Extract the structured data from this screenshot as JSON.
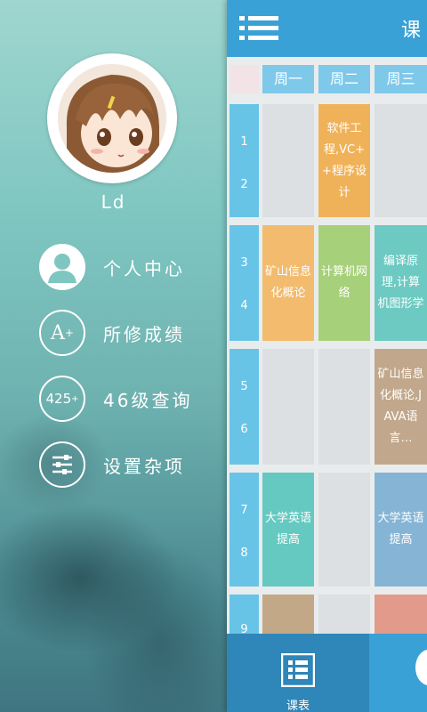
{
  "drawer": {
    "username": "Ld",
    "menu": [
      {
        "label": "个人中心",
        "icon": "person-icon"
      },
      {
        "label": "所修成绩",
        "icon": "grade-a-plus-icon",
        "icon_text": "A"
      },
      {
        "label": "46级查询",
        "icon": "cet-425-icon",
        "icon_text": "425"
      },
      {
        "label": "设置杂项",
        "icon": "settings-sliders-icon"
      }
    ]
  },
  "appbar": {
    "title": "课"
  },
  "timetable": {
    "days": [
      "周一",
      "周二",
      "周三"
    ],
    "periods": [
      "1",
      "2",
      "3",
      "4",
      "5",
      "6",
      "7",
      "8",
      "9"
    ],
    "courses": [
      {
        "day": "周二",
        "periods": "1-2",
        "name": "软件工程,VC++程序设计",
        "color": "#f0b259"
      },
      {
        "day": "周一",
        "periods": "3-4",
        "name": "矿山信息化概论",
        "color": "#f2bb6e"
      },
      {
        "day": "周二",
        "periods": "3-4",
        "name": "计算机网络",
        "color": "#a6d07a"
      },
      {
        "day": "周三",
        "periods": "3-4",
        "name": "编译原理,计算机图形学",
        "color": "#6ccac2"
      },
      {
        "day": "周三",
        "periods": "5-6",
        "name": "矿山信息化概论,JAVA语言…",
        "color": "#c1a78b"
      },
      {
        "day": "周一",
        "periods": "7-8",
        "name": "大学英语提高",
        "color": "#65c9c1"
      },
      {
        "day": "周三",
        "periods": "7-8",
        "name": "大学英语提高",
        "color": "#86b4d5"
      },
      {
        "day": "周一",
        "periods": "9",
        "name": "",
        "color": "#c2a887"
      },
      {
        "day": "周三",
        "periods": "9",
        "name": "",
        "color": "#e29b8b"
      }
    ]
  },
  "bottom_nav": {
    "tabs": [
      {
        "label": "课表",
        "icon": "timetable-icon",
        "active": true
      },
      {
        "label": "",
        "icon": "second-tab-icon",
        "active": false
      }
    ]
  },
  "colors": {
    "primary": "#3aa1d6",
    "header_cell": "#7ec8ea",
    "period_cell": "#68c4e6",
    "empty_cell": "#dde0e2"
  }
}
